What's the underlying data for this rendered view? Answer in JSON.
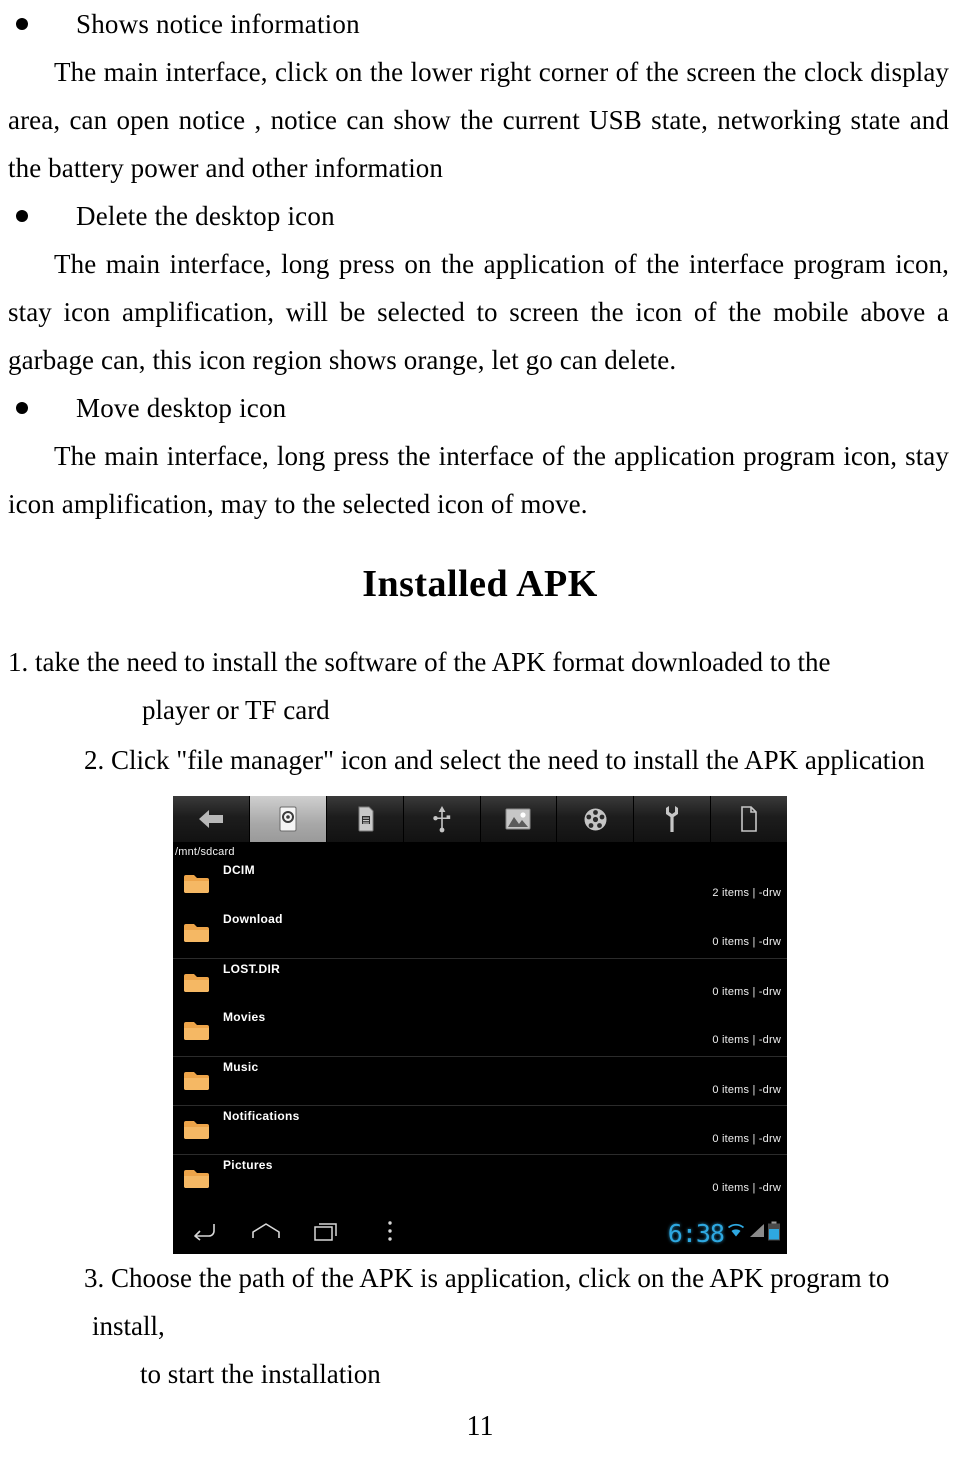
{
  "document": {
    "page_number": "11"
  },
  "sections": [
    {
      "bullet": "Shows notice information",
      "paragraph": "The main interface, click on the lower right corner of the screen the clock display area, can open notice , notice can show the current USB state, networking state and the battery power and other information"
    },
    {
      "bullet": "Delete the desktop icon",
      "paragraph": "The main interface, long press on the application of the interface program icon, stay icon amplification, will be selected to screen the icon of the mobile above a garbage can, this icon region shows orange, let go can delete."
    },
    {
      "bullet": "Move desktop icon",
      "paragraph": "The main interface, long press the interface of the application program icon, stay icon amplification, may to the selected icon of move."
    }
  ],
  "heading": {
    "installed_apk": "Installed APK"
  },
  "steps": [
    {
      "number": "1.",
      "text": "take the need to install the software of the APK format downloaded to the",
      "continuation": "player or TF card"
    },
    {
      "number": "2.",
      "text": "Click \"file manager\" icon and select the need to install the APK application",
      "continuation": ""
    },
    {
      "number": "3.",
      "text": "Choose the path of the APK is application, click on the APK program to install,",
      "continuation": "to start the installation"
    }
  ],
  "screenshot": {
    "app": "file-manager",
    "toolbar": [
      {
        "icon": "back-arrow-icon",
        "label": "Back",
        "active": false
      },
      {
        "icon": "internal-storage-icon",
        "label": "Internal storage",
        "active": true
      },
      {
        "icon": "sd-card-icon",
        "label": "SD card",
        "active": false
      },
      {
        "icon": "usb-icon",
        "label": "USB",
        "active": false
      },
      {
        "icon": "image-icon",
        "label": "Pictures",
        "active": false
      },
      {
        "icon": "film-reel-icon",
        "label": "Videos",
        "active": false
      },
      {
        "icon": "wrench-icon",
        "label": "Tools",
        "active": false
      },
      {
        "icon": "document-icon",
        "label": "Documents",
        "active": false
      }
    ],
    "path": "/mnt/sdcard",
    "files": [
      {
        "name": "DCIM",
        "meta": "2 items | -drw",
        "icon": "folder-icon",
        "separator": false
      },
      {
        "name": "Download",
        "meta": "0 items | -drw",
        "icon": "folder-icon",
        "separator": false
      },
      {
        "name": "LOST.DIR",
        "meta": "0 items | -drw",
        "icon": "folder-icon",
        "separator": true
      },
      {
        "name": "Movies",
        "meta": "0 items | -drw",
        "icon": "folder-icon",
        "separator": false
      },
      {
        "name": "Music",
        "meta": "0 items | -drw",
        "icon": "folder-icon",
        "separator": true
      },
      {
        "name": "Notifications",
        "meta": "0 items | -drw",
        "icon": "folder-icon",
        "separator": true
      },
      {
        "name": "Pictures",
        "meta": "0 items | -drw",
        "icon": "folder-icon",
        "separator": true
      }
    ],
    "navbar": {
      "buttons": [
        {
          "icon": "nav-back-icon",
          "label": "Back"
        },
        {
          "icon": "nav-home-icon",
          "label": "Home"
        },
        {
          "icon": "nav-recents-icon",
          "label": "Recent apps"
        },
        {
          "icon": "nav-menu-icon",
          "label": "Menu"
        }
      ],
      "clock": "6:38",
      "status_icons": [
        {
          "icon": "wifi-icon",
          "label": "Wi-Fi"
        },
        {
          "icon": "signal-icon",
          "label": "Signal"
        },
        {
          "icon": "battery-icon",
          "label": "Battery"
        }
      ]
    },
    "colors": {
      "folder": "#f0a84a",
      "accent": "#2ea8e0",
      "background": "#000000"
    }
  }
}
